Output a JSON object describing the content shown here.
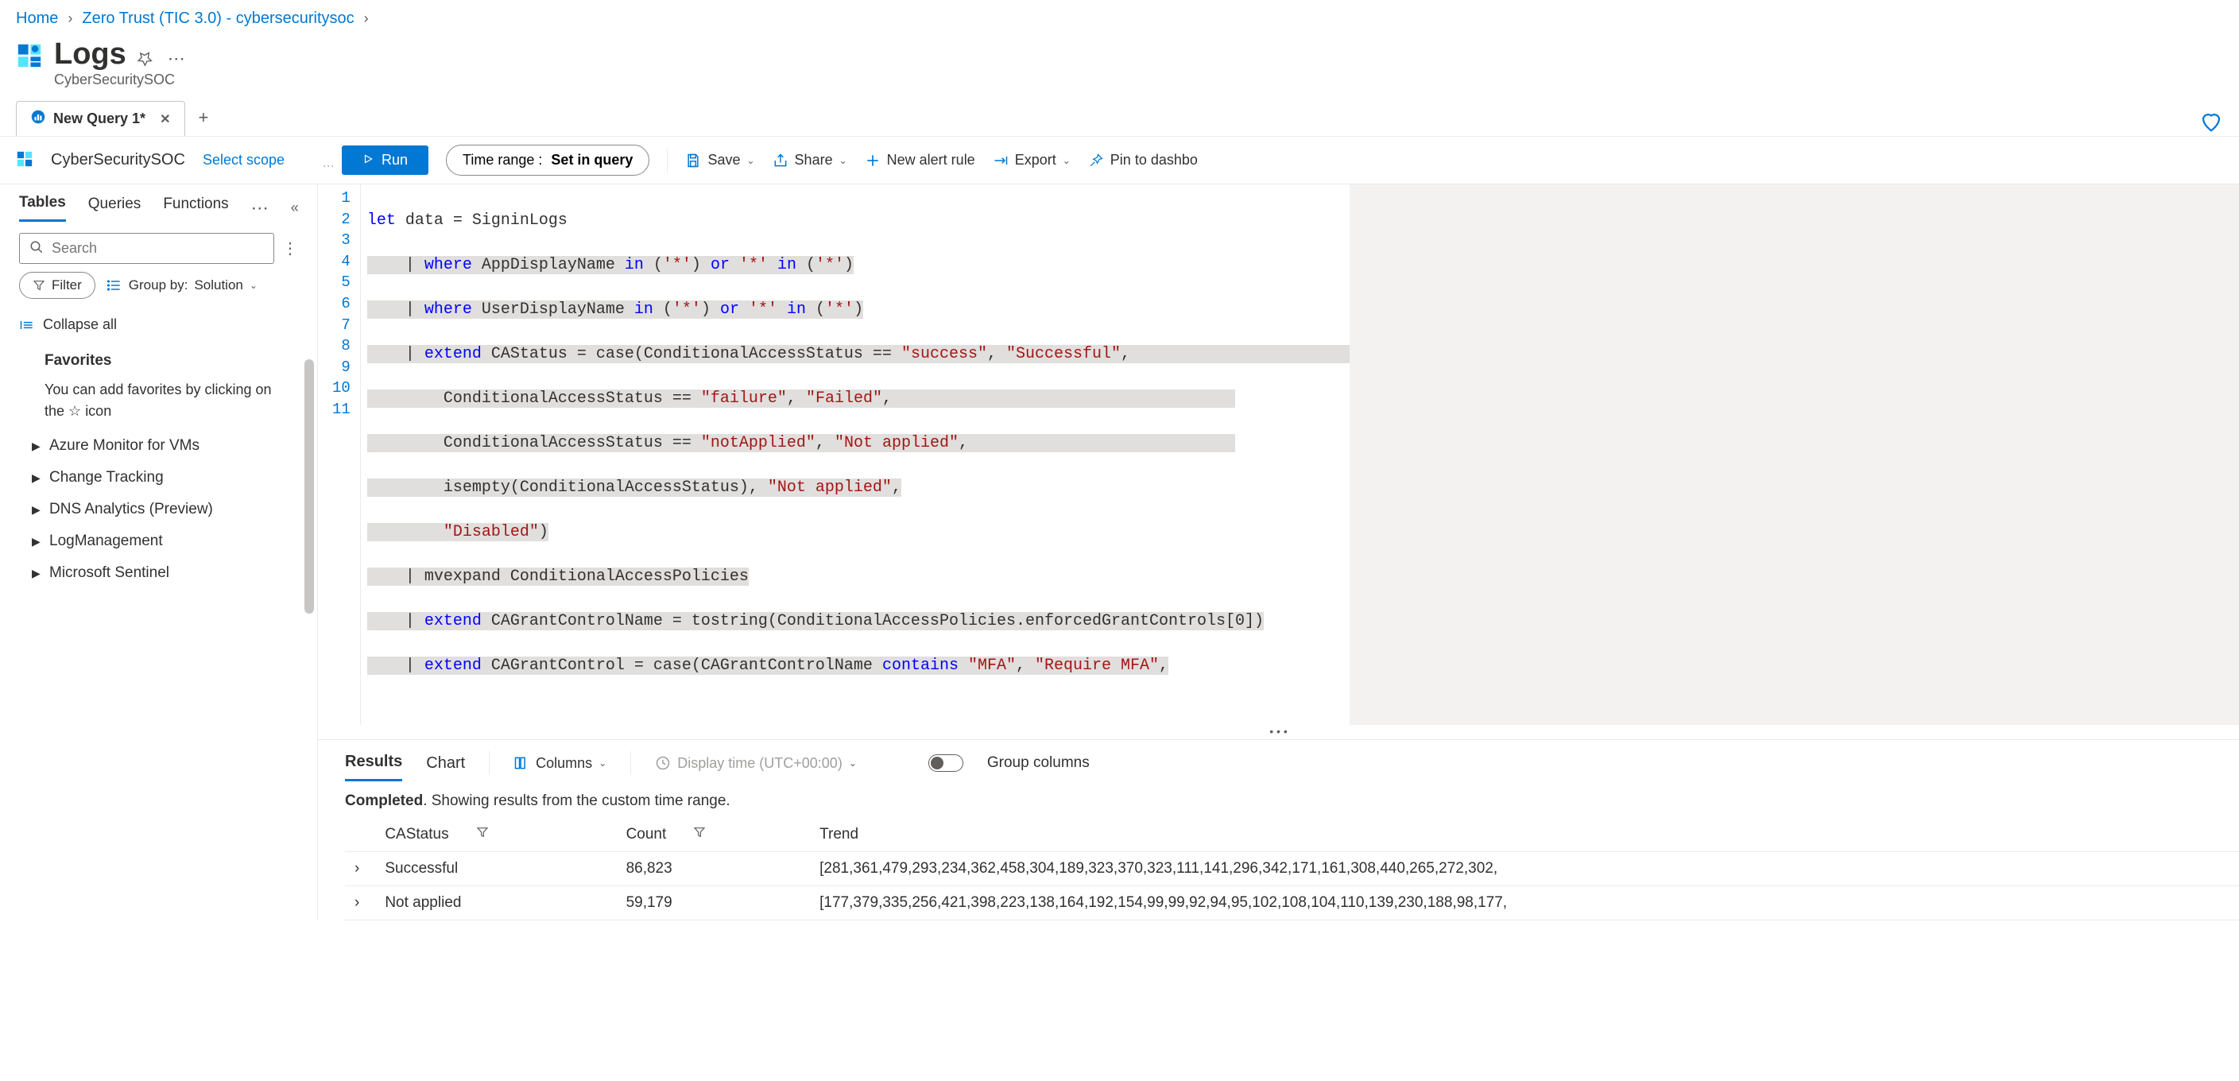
{
  "breadcrumb": {
    "home": "Home",
    "path": "Zero Trust (TIC 3.0) - cybersecuritysoc"
  },
  "header": {
    "title": "Logs",
    "subtitle": "CyberSecuritySOC"
  },
  "tab": {
    "label": "New Query 1*"
  },
  "workspace": {
    "name": "CyberSecuritySOC",
    "scope_link": "Select scope"
  },
  "toolbar": {
    "run": "Run",
    "time_range_label": "Time range :",
    "time_range_value": "Set in query",
    "save": "Save",
    "share": "Share",
    "new_alert": "New alert rule",
    "export": "Export",
    "pin": "Pin to dashbo"
  },
  "sidebar": {
    "tabs": {
      "tables": "Tables",
      "queries": "Queries",
      "functions": "Functions"
    },
    "search_placeholder": "Search",
    "filter": "Filter",
    "groupby_prefix": "Group by:",
    "groupby_value": "Solution",
    "collapse_all": "Collapse all",
    "favorites_title": "Favorites",
    "favorites_hint_1": "You can add favorites by clicking on the ",
    "favorites_hint_2": " icon",
    "tree": [
      "Azure Monitor for VMs",
      "Change Tracking",
      "DNS Analytics (Preview)",
      "LogManagement",
      "Microsoft Sentinel"
    ]
  },
  "editor": {
    "lines": [
      1,
      2,
      3,
      4,
      5,
      6,
      7,
      8,
      9,
      10,
      11
    ]
  },
  "results": {
    "tabs": {
      "results": "Results",
      "chart": "Chart"
    },
    "columns_btn": "Columns",
    "display_time": "Display time (UTC+00:00)",
    "group_columns": "Group columns",
    "status_bold": "Completed",
    "status_rest": ". Showing results from the custom time range.",
    "headers": {
      "castatus": "CAStatus",
      "count": "Count",
      "trend": "Trend"
    },
    "rows": [
      {
        "status": "Successful",
        "count": "86,823",
        "trend": "[281,361,479,293,234,362,458,304,189,323,370,323,111,141,296,342,171,161,308,440,265,272,302,"
      },
      {
        "status": "Not applied",
        "count": "59,179",
        "trend": "[177,379,335,256,421,398,223,138,164,192,154,99,99,92,94,95,102,108,104,110,139,230,188,98,177,"
      }
    ]
  },
  "chart_data": {
    "type": "table",
    "title": "Conditional Access Status Counts",
    "columns": [
      "CAStatus",
      "Count"
    ],
    "rows": [
      [
        "Successful",
        86823
      ],
      [
        "Not applied",
        59179
      ]
    ],
    "trend_series": [
      {
        "name": "Successful",
        "values": [
          281,
          361,
          479,
          293,
          234,
          362,
          458,
          304,
          189,
          323,
          370,
          323,
          111,
          141,
          296,
          342,
          171,
          161,
          308,
          440,
          265,
          272,
          302
        ]
      },
      {
        "name": "Not applied",
        "values": [
          177,
          379,
          335,
          256,
          421,
          398,
          223,
          138,
          164,
          192,
          154,
          99,
          99,
          92,
          94,
          95,
          102,
          108,
          104,
          110,
          139,
          230,
          188,
          98,
          177
        ]
      }
    ]
  }
}
